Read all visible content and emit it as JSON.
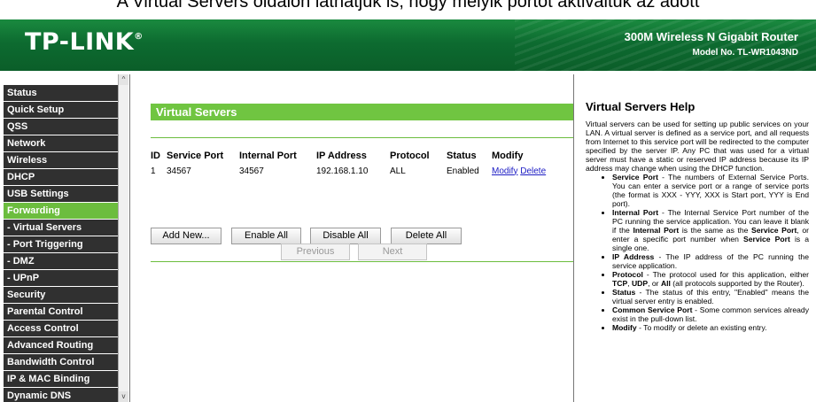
{
  "caption": "A Virtual Servers oldalon láthatjuk is, hogy melyik portot aktiváltuk az adott",
  "header": {
    "logo": "TP-LINK",
    "logo_mark": "®",
    "product": "300M Wireless N Gigabit Router",
    "model": "Model No. TL-WR1043ND"
  },
  "sidebar": {
    "items": [
      {
        "label": "Status"
      },
      {
        "label": "Quick Setup"
      },
      {
        "label": "QSS"
      },
      {
        "label": "Network"
      },
      {
        "label": "Wireless"
      },
      {
        "label": "DHCP"
      },
      {
        "label": "USB Settings"
      },
      {
        "label": "Forwarding"
      },
      {
        "label": "- Virtual Servers"
      },
      {
        "label": "- Port Triggering"
      },
      {
        "label": "- DMZ"
      },
      {
        "label": "- UPnP"
      },
      {
        "label": "Security"
      },
      {
        "label": "Parental Control"
      },
      {
        "label": "Access Control"
      },
      {
        "label": "Advanced Routing"
      },
      {
        "label": "Bandwidth Control"
      },
      {
        "label": "IP & MAC Binding"
      },
      {
        "label": "Dynamic DNS"
      }
    ],
    "scroll_up": "^",
    "scroll_down": "v"
  },
  "main": {
    "title": "Virtual Servers",
    "table": {
      "headers": [
        "ID",
        "Service Port",
        "Internal Port",
        "IP Address",
        "Protocol",
        "Status",
        "Modify"
      ],
      "rows": [
        {
          "id": "1",
          "service_port": "34567",
          "internal_port": "34567",
          "ip_address": "192.168.1.10",
          "protocol": "ALL",
          "status": "Enabled",
          "modify": "Modify",
          "delete": "Delete"
        }
      ]
    },
    "buttons": {
      "add_new": "Add New...",
      "enable_all": "Enable All",
      "disable_all": "Disable All",
      "delete_all": "Delete All"
    },
    "pager": {
      "previous": "Previous",
      "next": "Next"
    }
  },
  "help": {
    "title": "Virtual Servers Help",
    "intro": "Virtual servers can be used for setting up public services on your LAN. A virtual server is defined as a service port, and all requests from Internet to this service port will be redirected to the computer specified by the server IP. Any PC that was used for a virtual server must have a static or reserved IP address because its IP address may change when using the DHCP function.",
    "items": [
      {
        "term": "Service Port",
        "text": " - The numbers of External Service Ports. You can enter a service port or a range of service ports (the format is XXX - YYY, XXX is Start port, YYY is End port)."
      },
      {
        "term": "Internal Port",
        "text": " - The Internal Service Port number of the PC running the service application. You can leave it blank if the ",
        "term2": "Internal Port",
        "text2": " is the same as the ",
        "term3": "Service Port",
        "text3": ", or enter a specific port number when ",
        "term4": "Service Port",
        "text4": " is a single one."
      },
      {
        "term": "IP Address",
        "text": " - The IP address of the PC running the service application."
      },
      {
        "term": "Protocol",
        "text": " - The protocol used for this application, either ",
        "term2": "TCP",
        "text2": ", ",
        "term3": "UDP",
        "text3": ", or ",
        "term4": "All",
        "text4": " (all protocols supported by the Router)."
      },
      {
        "term": "Status",
        "text": " - The status of this entry, \"Enabled\" means the virtual server entry is enabled."
      },
      {
        "term": "Common Service Port",
        "text": " - Some common services already exist in the pull-down list."
      },
      {
        "term": "Modify",
        "text": " - To modify or delete an existing entry."
      }
    ]
  },
  "colors": {
    "header_green": "#0d6b30",
    "accent_green": "#6cbd3e",
    "menu_dark": "#303030",
    "link_blue": "#1c1cc4"
  }
}
